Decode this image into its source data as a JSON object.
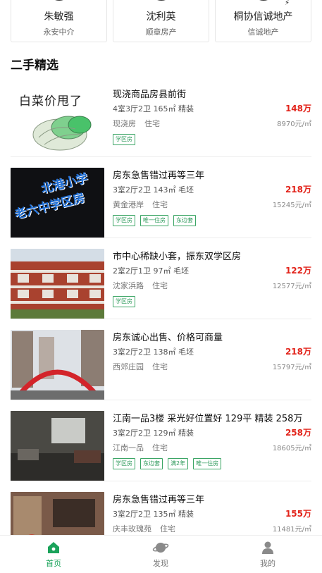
{
  "agents": [
    {
      "name": "朱敏强",
      "company": "永安中介"
    },
    {
      "name": "沈利英",
      "company": "顺章房产"
    },
    {
      "name": "桐协信诚地产",
      "company": "信诚地产"
    }
  ],
  "section_title": "二手精选",
  "thumb_texts": {
    "item0": "白菜价甩了",
    "item1_line1": "北港小学",
    "item1_line2": "老六中学区房"
  },
  "listings": [
    {
      "title": "现浇商品房县前街",
      "spec": "4室3厅2卫 165㎡ 精装",
      "price": "148万",
      "community": "现浇房",
      "type": "住宅",
      "unit_price": "8970元/㎡",
      "tags": [
        "学区房"
      ]
    },
    {
      "title": "房东急售错过再等三年",
      "spec": "3室2厅2卫 143㎡ 毛坯",
      "price": "218万",
      "community": "黄金港岸",
      "type": "住宅",
      "unit_price": "15245元/㎡",
      "tags": [
        "学区房",
        "唯一住房",
        "东边套"
      ]
    },
    {
      "title": "市中心稀缺小套，振东双学区房",
      "spec": "2室2厅1卫 97㎡ 毛坯",
      "price": "122万",
      "community": "沈家浜路",
      "type": "住宅",
      "unit_price": "12577元/㎡",
      "tags": [
        "学区房"
      ]
    },
    {
      "title": "房东诚心出售、价格可商量",
      "spec": "3室2厅2卫 138㎡ 毛坯",
      "price": "218万",
      "community": "西郊庄园",
      "type": "住宅",
      "unit_price": "15797元/㎡",
      "tags": []
    },
    {
      "title": "江南一品3楼 采光好位置好 129平 精装 258万",
      "spec": "3室2厅2卫 129㎡ 精装",
      "price": "258万",
      "community": "江南一品",
      "type": "住宅",
      "unit_price": "18605元/㎡",
      "tags": [
        "学区房",
        "东边套",
        "满2年",
        "唯一住房"
      ]
    },
    {
      "title": "房东急售错过再等三年",
      "spec": "3室2厅2卫 135㎡ 精装",
      "price": "155万",
      "community": "庆丰玫瑰苑",
      "type": "住宅",
      "unit_price": "11481元/㎡",
      "tags": []
    }
  ],
  "tabs": [
    {
      "label": "首页",
      "icon": "home-icon",
      "active": true
    },
    {
      "label": "发现",
      "icon": "planet-icon",
      "active": false
    },
    {
      "label": "我的",
      "icon": "user-icon",
      "active": false
    }
  ],
  "colors": {
    "accent": "#1aa35a",
    "price": "#e2231a",
    "tag": "#2e9a5b"
  }
}
